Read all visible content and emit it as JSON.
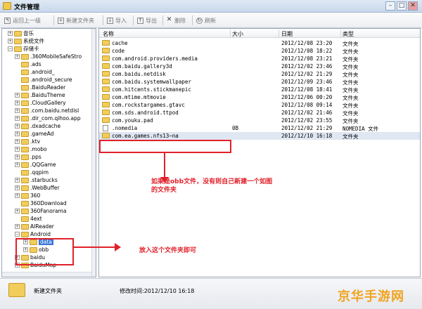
{
  "window": {
    "title": "文件管理",
    "controls": [
      "–",
      "□",
      "✕"
    ]
  },
  "toolbar": {
    "back_label": "返回上一级",
    "new_folder_label": "新建文件夹",
    "import_label": "导入",
    "export_label": "导出",
    "delete_label": "删除",
    "refresh_label": "刷新"
  },
  "tree": {
    "items": [
      {
        "label": "音乐",
        "expander": "+",
        "level": 0
      },
      {
        "label": "系统文件",
        "expander": "+",
        "level": 0
      },
      {
        "label": "存储卡",
        "expander": "−",
        "level": 0
      },
      {
        "label": ".360MobileSafeStro",
        "expander": "+",
        "level": 1
      },
      {
        "label": ".ads",
        "expander": "",
        "level": 1
      },
      {
        "label": ".android_",
        "expander": "",
        "level": 1
      },
      {
        "label": ".android_secure",
        "expander": "",
        "level": 1
      },
      {
        "label": ".BaiduReader",
        "expander": "",
        "level": 1
      },
      {
        "label": ".BaiduTheme",
        "expander": "+",
        "level": 1
      },
      {
        "label": ".CloudGallery",
        "expander": "+",
        "level": 1
      },
      {
        "label": ".com.baidu.netdisl",
        "expander": "+",
        "level": 1
      },
      {
        "label": ".dir_com.qihoo.app",
        "expander": "+",
        "level": 1
      },
      {
        "label": ".dxadcache",
        "expander": "+",
        "level": 1
      },
      {
        "label": ".gameAd",
        "expander": "+",
        "level": 1
      },
      {
        "label": ".ktv",
        "expander": "+",
        "level": 1
      },
      {
        "label": ".mobo",
        "expander": "+",
        "level": 1
      },
      {
        "label": ".pps",
        "expander": "+",
        "level": 1
      },
      {
        "label": ".QQGame",
        "expander": "+",
        "level": 1
      },
      {
        "label": ".qqpim",
        "expander": "",
        "level": 1
      },
      {
        "label": ".starbucks",
        "expander": "+",
        "level": 1
      },
      {
        "label": ".WebBuffer",
        "expander": "+",
        "level": 1
      },
      {
        "label": "360",
        "expander": "+",
        "level": 1
      },
      {
        "label": "360Download",
        "expander": "",
        "level": 1
      },
      {
        "label": "360Fanorama",
        "expander": "+",
        "level": 1
      },
      {
        "label": "4ext",
        "expander": "",
        "level": 1
      },
      {
        "label": "AIReader",
        "expander": "+",
        "level": 1
      },
      {
        "label": "Android",
        "expander": "−",
        "level": 1
      },
      {
        "label": "data",
        "expander": "+",
        "level": 2,
        "selected": true
      },
      {
        "label": "obb",
        "expander": "+",
        "level": 2
      },
      {
        "label": "baidu",
        "expander": "+",
        "level": 1
      },
      {
        "label": "BaiduMap",
        "expander": "+",
        "level": 1
      }
    ]
  },
  "list": {
    "columns": [
      "名称",
      "大小",
      "日期",
      "类型"
    ],
    "rows": [
      {
        "name": "cache",
        "size": "",
        "date": "2012/12/08 23:20",
        "type": "文件夹",
        "icon": "folder"
      },
      {
        "name": "code",
        "size": "",
        "date": "2012/12/08 18:22",
        "type": "文件夹",
        "icon": "folder"
      },
      {
        "name": "com.android.providers.media",
        "size": "",
        "date": "2012/12/08 23:21",
        "type": "文件夹",
        "icon": "folder"
      },
      {
        "name": "com.baidu.gallery3d",
        "size": "",
        "date": "2012/12/02 23:46",
        "type": "文件夹",
        "icon": "folder"
      },
      {
        "name": "com.baidu.netdisk",
        "size": "",
        "date": "2012/12/02 21:29",
        "type": "文件夹",
        "icon": "folder"
      },
      {
        "name": "com.baidu.systemwallpaper",
        "size": "",
        "date": "2012/12/09 23:46",
        "type": "文件夹",
        "icon": "folder"
      },
      {
        "name": "com.hitcents.stickmanepic",
        "size": "",
        "date": "2012/12/08 18:41",
        "type": "文件夹",
        "icon": "folder"
      },
      {
        "name": "com.mtime.mtmovie",
        "size": "",
        "date": "2012/12/06 00:20",
        "type": "文件夹",
        "icon": "folder"
      },
      {
        "name": "com.rockstargames.gtavc",
        "size": "",
        "date": "2012/12/08 09:14",
        "type": "文件夹",
        "icon": "folder"
      },
      {
        "name": "com.sds.android.ttpod",
        "size": "",
        "date": "2012/12/02 21:46",
        "type": "文件夹",
        "icon": "folder"
      },
      {
        "name": "com.youku.pad",
        "size": "",
        "date": "2012/12/02 23:55",
        "type": "文件夹",
        "icon": "folder"
      },
      {
        "name": ".nomedia",
        "size": "0B",
        "date": "2012/12/02 21:29",
        "type": "NOMEDIA 文件",
        "icon": "file"
      },
      {
        "name": "com.ea.games.nfs13~na",
        "size": "",
        "date": "2012/12/10 16:18",
        "type": "文件夹",
        "icon": "folder",
        "selected": true
      }
    ]
  },
  "annotations": {
    "obb_note": "如果是obb文件，没有则自己新建一个如图的文件夹",
    "data_note": "放入这个文件夹即可"
  },
  "status": {
    "name": "新建文件夹",
    "modified": "修改时间:2012/12/10 16:18"
  },
  "watermark": "京华手游网",
  "colors": {
    "accent_red": "#e2202a",
    "folder_yellow": "#f1cd5c",
    "watermark_orange": "#f0a31f"
  }
}
